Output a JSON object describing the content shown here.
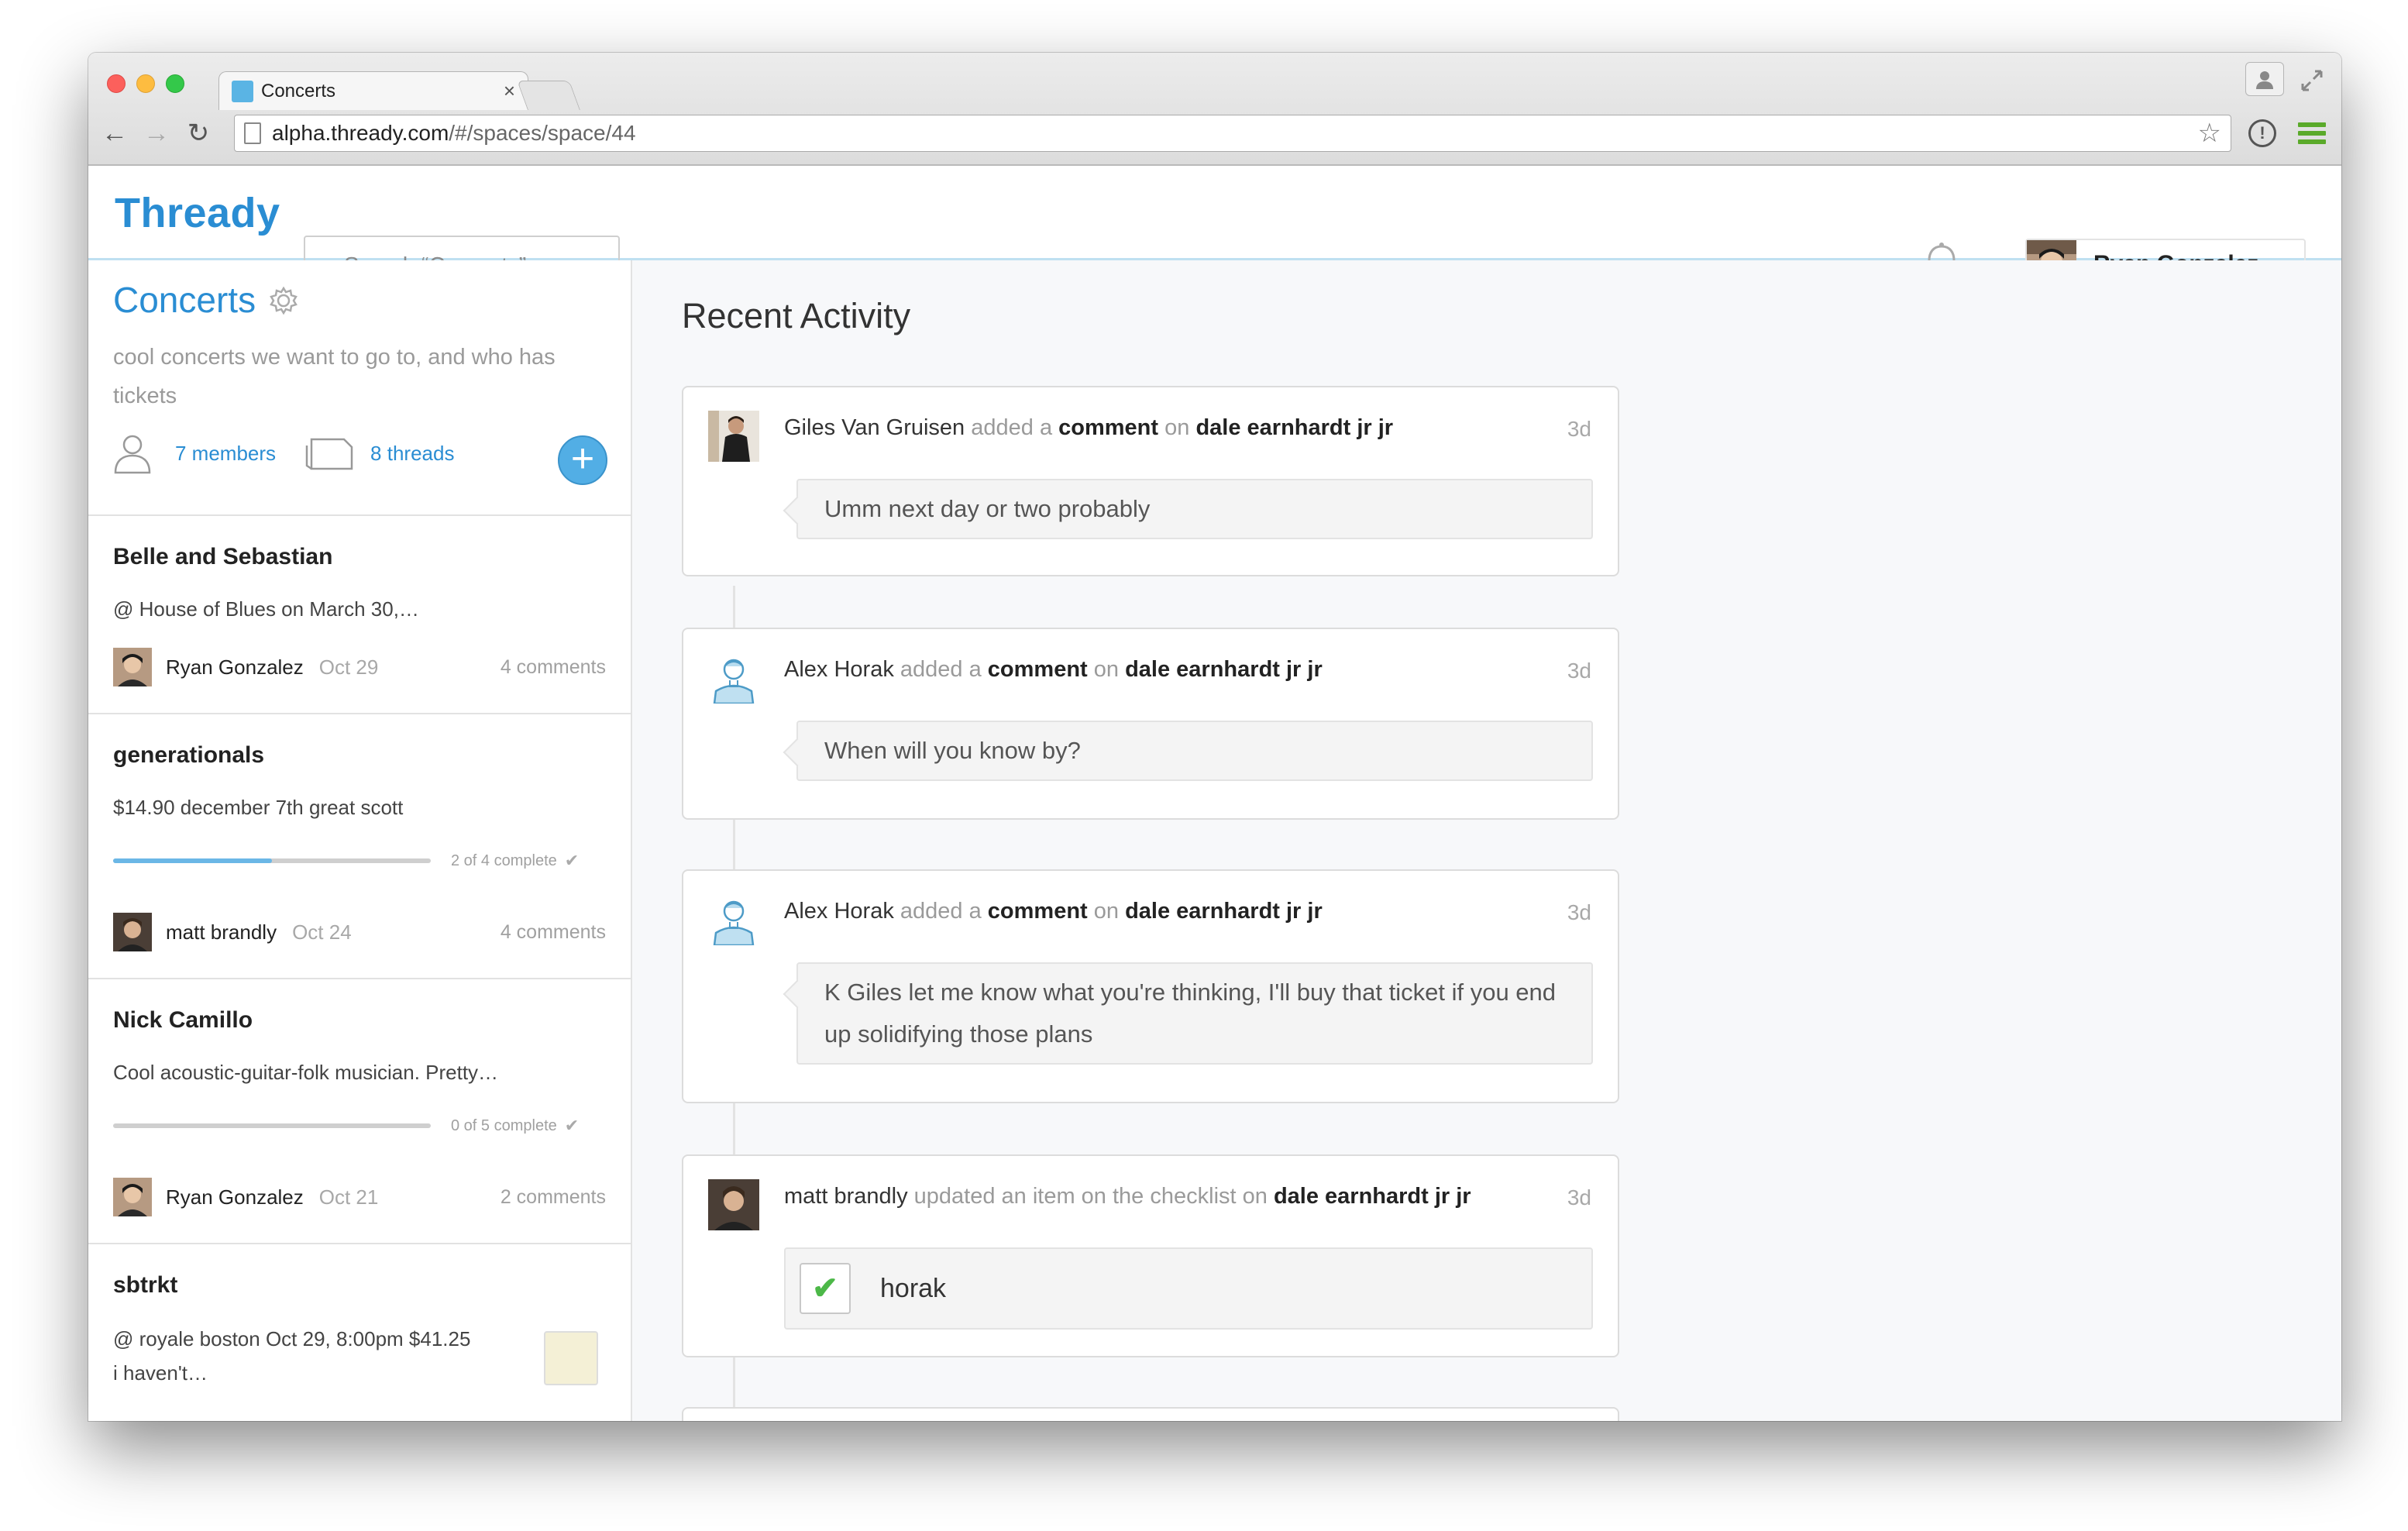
{
  "browser": {
    "tab_title": "Concerts",
    "tab_close": "×",
    "url_host": "alpha.thready.com",
    "url_path": "/#/spaces/space/44",
    "back": "←",
    "forward": "→",
    "reload": "↻",
    "star": "☆",
    "info": "!"
  },
  "header": {
    "logo": "Thready",
    "search_placeholder": "Search “Concerts”",
    "user_name": "Ryan Gonzalez"
  },
  "space": {
    "title": "Concerts",
    "description": "cool concerts we want to go to, and who has tickets",
    "members": "7 members",
    "threads": "8 threads",
    "add_label": "+"
  },
  "threads": [
    {
      "title": "Belle and Sebastian",
      "snippet": "@ House of Blues on March 30,…",
      "author": "Ryan Gonzalez",
      "date": "Oct 29",
      "comments": "4 comments"
    },
    {
      "title": "generationals",
      "snippet": "$14.90 december 7th great scott",
      "progress_label": "2 of 4 complete",
      "progress": 0.5,
      "author": "matt brandly",
      "date": "Oct 24",
      "comments": "4 comments"
    },
    {
      "title": "Nick Camillo",
      "snippet": "Cool acoustic-guitar-folk musician. Pretty…",
      "progress_label": "0 of 5 complete",
      "progress": 0,
      "author": "Ryan Gonzalez",
      "date": "Oct 21",
      "comments": "2 comments"
    },
    {
      "title": "sbtrkt",
      "snippet": "@ royale boston Oct 29, 8:00pm $41.25 i haven't…"
    }
  ],
  "main": {
    "title": "Recent Activity",
    "activities": [
      {
        "actor": "Giles Van Gruisen",
        "action": "added a",
        "object": "comment",
        "preposition": "on",
        "target": "dale earnhardt jr jr",
        "time": "3d",
        "text": "Umm next day or two probably"
      },
      {
        "actor": "Alex Horak",
        "action": "added a",
        "object": "comment",
        "preposition": "on",
        "target": "dale earnhardt jr jr",
        "time": "3d",
        "text": "When will you know by?"
      },
      {
        "actor": "Alex Horak",
        "action": "added a",
        "object": "comment",
        "preposition": "on",
        "target": "dale earnhardt jr jr",
        "time": "3d",
        "text": "K Giles let me know what you're thinking, I'll buy that ticket if you end up solidifying those plans"
      },
      {
        "actor": "matt brandly",
        "action": "updated an item on the checklist on",
        "target": "dale earnhardt jr jr",
        "time": "3d",
        "check_label": "horak",
        "checked": true,
        "check_mark": "✔"
      }
    ]
  },
  "colors": {
    "accent": "#2a8dd3",
    "progress": "#6bb7e6",
    "check": "#4cb848"
  }
}
